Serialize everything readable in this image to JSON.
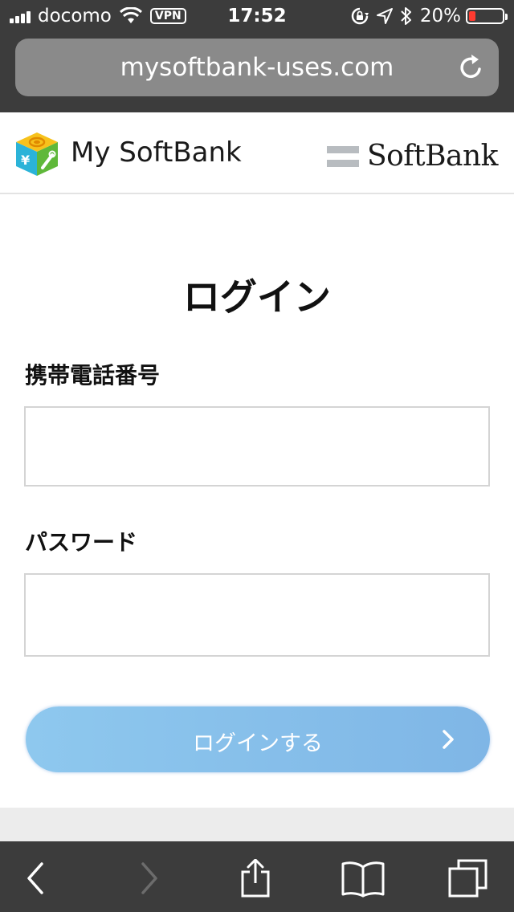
{
  "status_bar": {
    "carrier": "docomo",
    "vpn": "VPN",
    "time": "17:52",
    "battery_percent": "20%",
    "battery_level": 0.2,
    "battery_color": "#ff3b30"
  },
  "browser": {
    "url": "mysoftbank-uses.com"
  },
  "header": {
    "app_logo_text": "My SoftBank",
    "brand_text": "SoftBank"
  },
  "login": {
    "title": "ログイン",
    "phone_label": "携帯電話番号",
    "phone_value": "",
    "password_label": "パスワード",
    "password_value": "",
    "submit_label": "ログインする",
    "button_color": "#7fb6e6"
  },
  "toolbar": {
    "items": [
      "back-icon",
      "forward-icon",
      "share-icon",
      "bookmarks-icon",
      "tabs-icon"
    ]
  }
}
